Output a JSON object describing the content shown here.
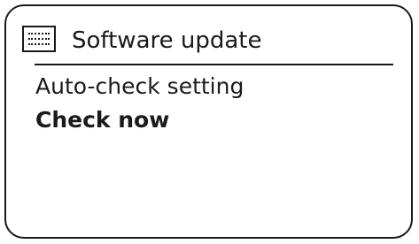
{
  "header": {
    "title": "Software update",
    "icon": "menu-list-icon"
  },
  "menu": {
    "items": [
      {
        "label": "Auto-check setting",
        "selected": false
      },
      {
        "label": "Check now",
        "selected": true
      }
    ]
  }
}
